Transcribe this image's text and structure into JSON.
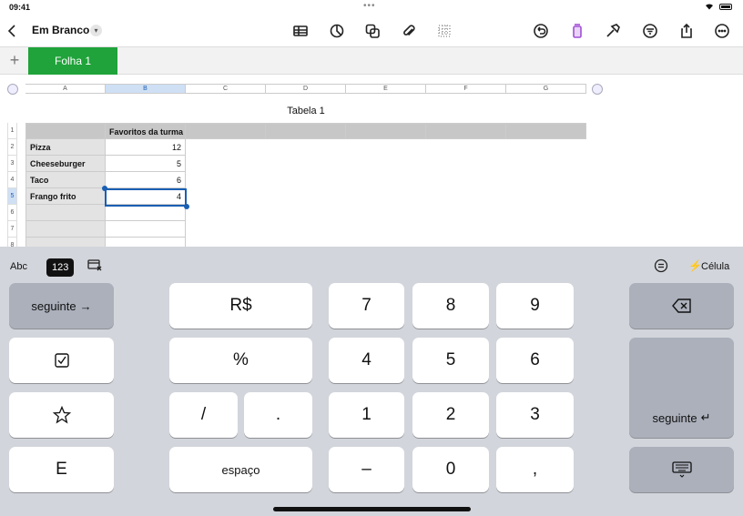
{
  "status": {
    "time": "09:41"
  },
  "toolbar": {
    "back_icon": "chevron-left-icon",
    "doc_title": "Em Branco"
  },
  "tabs": {
    "active_sheet": "Folha 1"
  },
  "sheet": {
    "table_title": "Tabela 1",
    "columns": [
      "A",
      "B",
      "C",
      "D",
      "E",
      "F",
      "G"
    ],
    "rows": [
      "1",
      "2",
      "3",
      "4",
      "5",
      "6",
      "7",
      "8"
    ],
    "header_b": "Favoritos da turma",
    "items": [
      {
        "label": "Pizza",
        "value": "12"
      },
      {
        "label": "Cheeseburger",
        "value": "5"
      },
      {
        "label": "Taco",
        "value": "6"
      },
      {
        "label": "Frango frito",
        "value": "4"
      }
    ],
    "selected_row": "5",
    "selected_col": "B"
  },
  "keyboard": {
    "mode_abc": "Abc",
    "mode_123": "123",
    "cell_label": "Célula",
    "next": "seguinte",
    "currency": "R$",
    "percent": "%",
    "slash": "/",
    "dot": ".",
    "space": "espaço",
    "and": "E",
    "digits": [
      "7",
      "8",
      "9",
      "4",
      "5",
      "6",
      "1",
      "2",
      "3",
      "0"
    ],
    "minus": "–",
    "comma": ",",
    "next_enter": "seguinte"
  }
}
